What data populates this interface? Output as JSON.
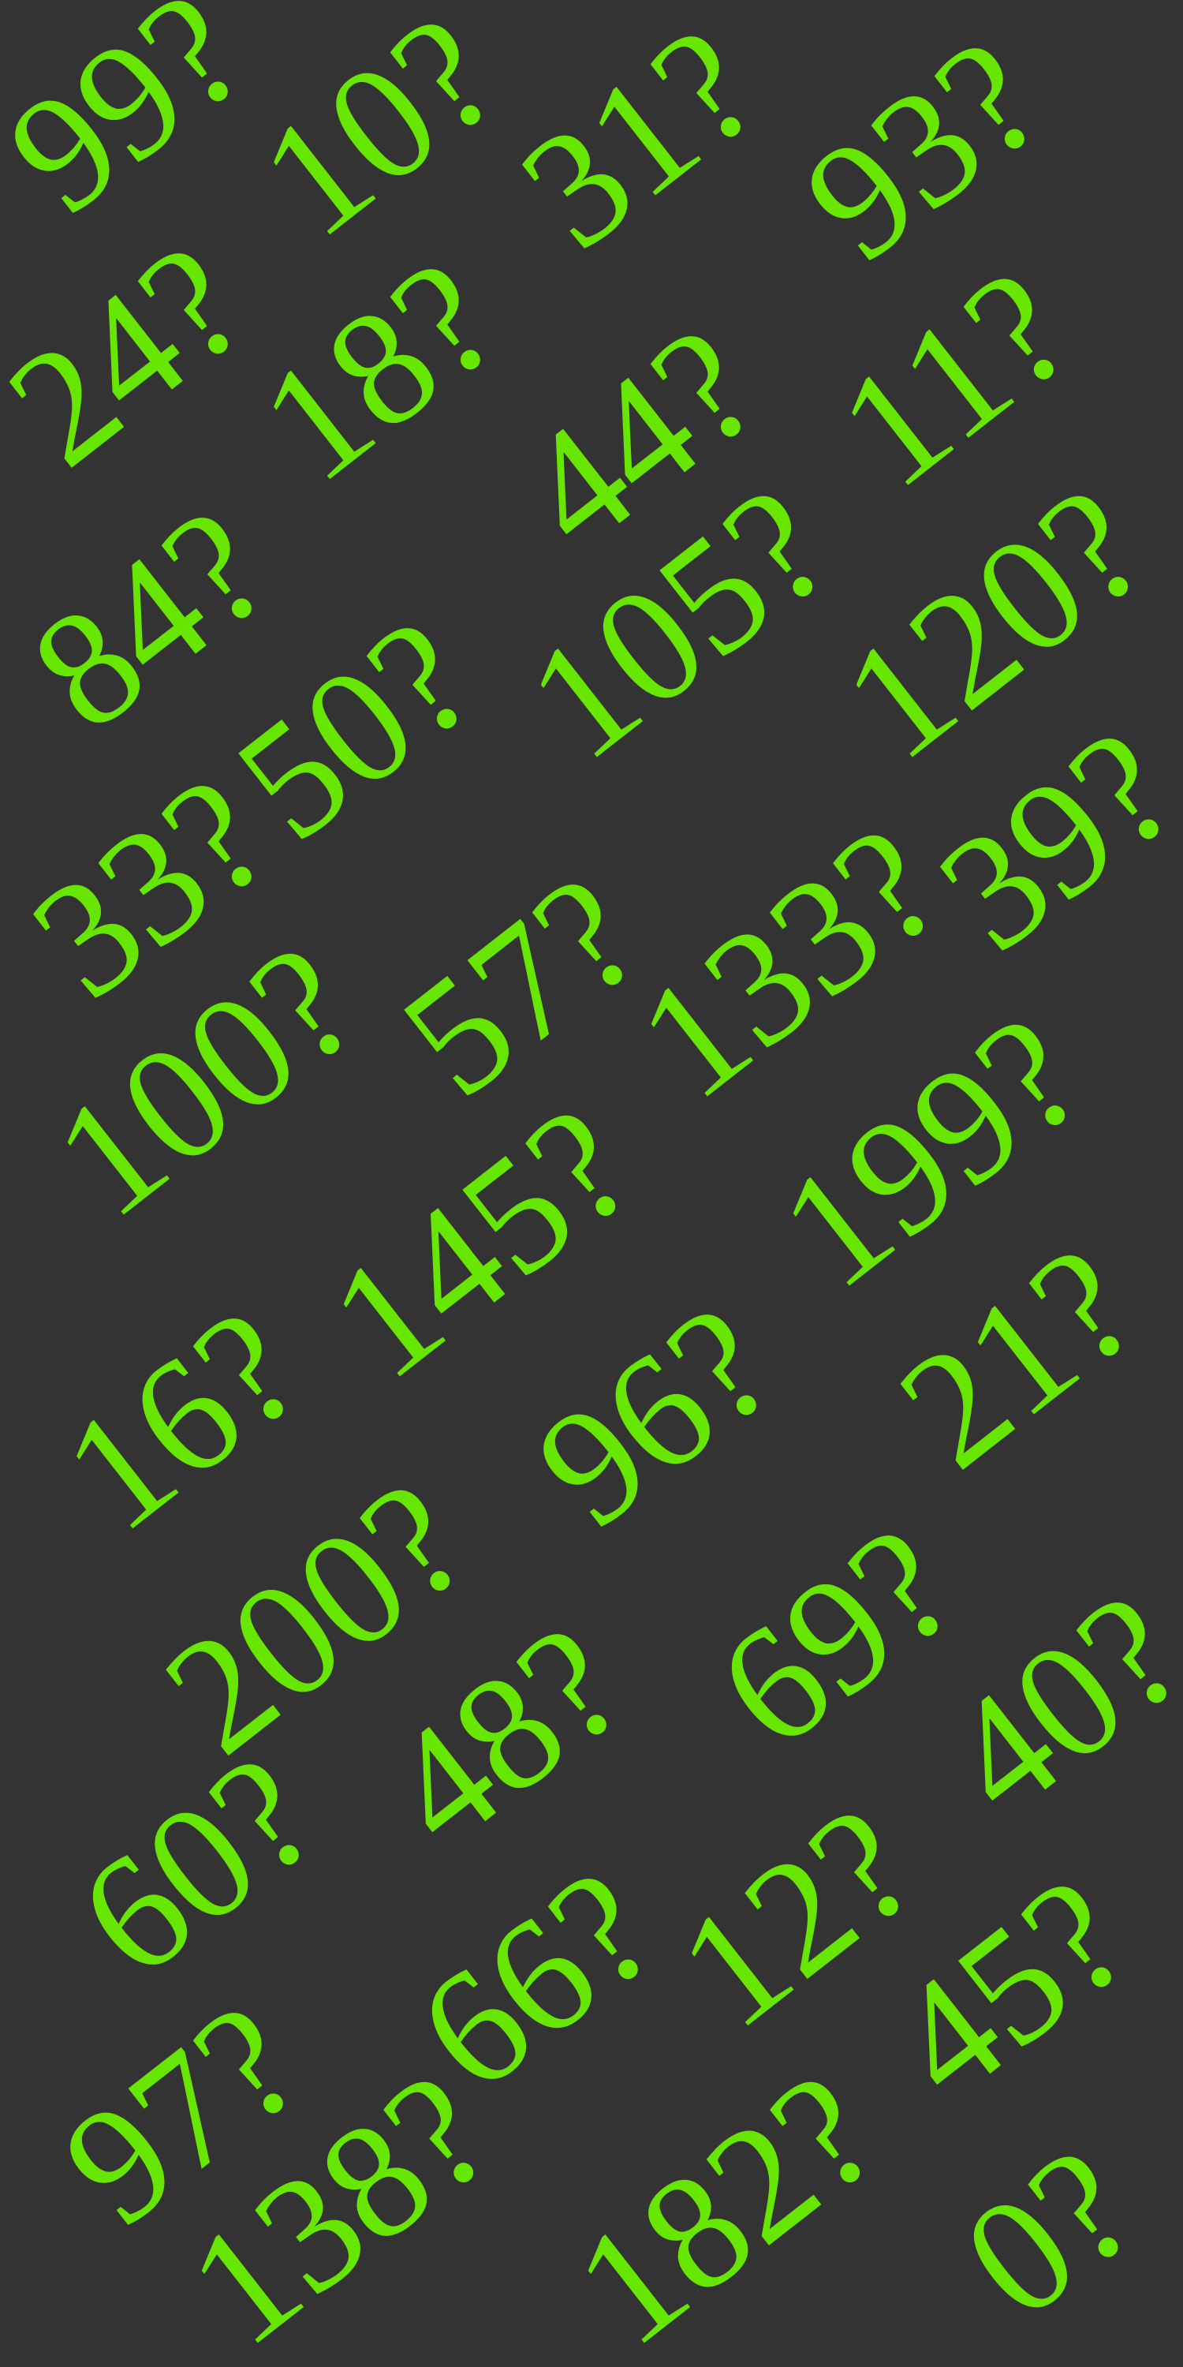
{
  "colors": {
    "background": "#333333",
    "text": "#66e600"
  },
  "words": [
    "99?",
    "10?",
    "31?",
    "93?",
    "24?",
    "18?",
    "44?",
    "11?",
    "84?",
    "105?",
    "120?",
    "50?",
    "33?",
    "39?",
    "133?",
    "57?",
    "100?",
    "199?",
    "145?",
    "16?",
    "96?",
    "21?",
    "200?",
    "69?",
    "48?",
    "40?",
    "60?",
    "12?",
    "45?",
    "66?",
    "97?",
    "182?",
    "138?",
    "0?"
  ]
}
